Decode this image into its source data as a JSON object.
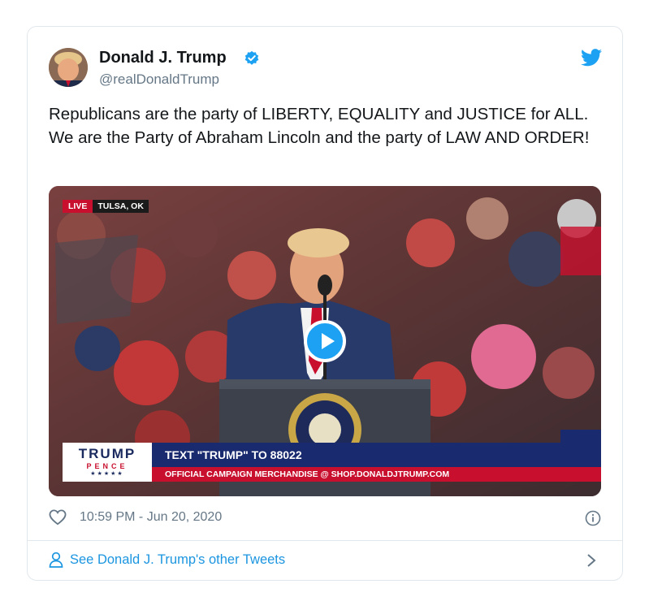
{
  "tweet": {
    "author_name": "Donald J. Trump",
    "handle": "@realDonaldTrump",
    "text": "Republicans are the party of LIBERTY, EQUALITY and JUSTICE for ALL. We are the Party of Abraham Lincoln and the party of LAW AND ORDER!",
    "timestamp": "10:59 PM - Jun 20, 2020"
  },
  "video": {
    "live_label": "LIVE",
    "location": "TULSA, OK",
    "logo_line1": "TRUMP",
    "logo_line2": "PENCE",
    "logo_stars": "★★★★★",
    "banner_main": "TEXT \"TRUMP\" TO 88022",
    "banner_sub": "OFFICIAL CAMPAIGN MERCHANDISE @ SHOP.DONALDJTRUMP.COM"
  },
  "footer": {
    "see_more": "See Donald J. Trump's other Tweets"
  },
  "colors": {
    "twitter_blue": "#1da1f2",
    "link_blue": "#1b95e0",
    "text_primary": "#14171a",
    "text_secondary": "#657786",
    "border": "#e1e8ed"
  },
  "icons": [
    "avatar",
    "verified-badge-icon",
    "twitter-bird-icon",
    "play-icon",
    "heart-icon",
    "info-icon",
    "person-icon",
    "chevron-right-icon"
  ]
}
